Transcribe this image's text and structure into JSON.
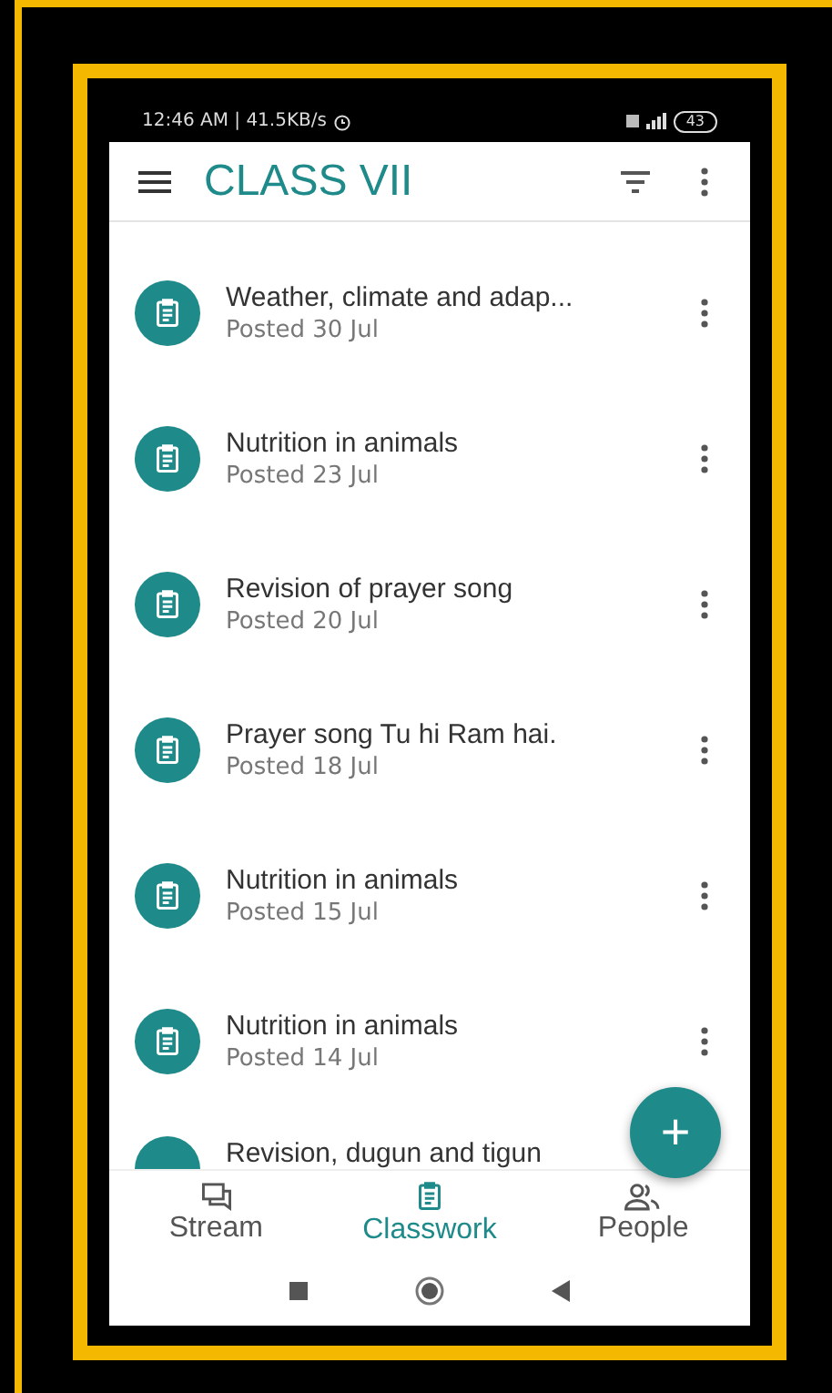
{
  "status_bar": {
    "time": "12:46 AM | 41.5KB/s",
    "battery": "43"
  },
  "app_bar": {
    "title": "CLASS VII"
  },
  "assignments": [
    {
      "title": "Weather, climate and adap...",
      "posted": "Posted 30 Jul"
    },
    {
      "title": "Nutrition in animals",
      "posted": "Posted 23 Jul"
    },
    {
      "title": "Revision of prayer song",
      "posted": "Posted 20 Jul"
    },
    {
      "title": "Prayer song Tu hi Ram hai.",
      "posted": "Posted 18 Jul"
    },
    {
      "title": "Nutrition in animals",
      "posted": "Posted 15 Jul"
    },
    {
      "title": "Nutrition in animals",
      "posted": "Posted 14 Jul"
    },
    {
      "title": "Revision, dugun and tigun"
    }
  ],
  "fab": {
    "label": "+"
  },
  "tabs": [
    {
      "label": "Stream",
      "kind": "stream",
      "selected": false
    },
    {
      "label": "Classwork",
      "kind": "classwork",
      "selected": true
    },
    {
      "label": "People",
      "kind": "people",
      "selected": false
    }
  ]
}
